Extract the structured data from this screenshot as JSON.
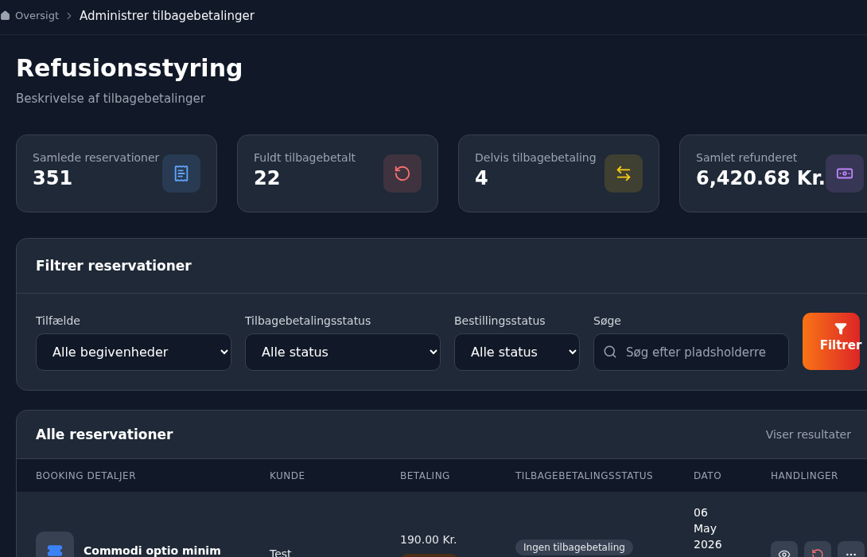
{
  "breadcrumb": [
    {
      "label": "Oversigt",
      "kind": "home"
    },
    {
      "label": "Administrer tilbagebetalinger",
      "kind": "current"
    }
  ],
  "header": {
    "title": "Refusionsstyring",
    "subtitle": "Beskrivelse af tilbagebetalinger"
  },
  "stats": [
    {
      "label": "Samlede reservationer",
      "value": "351",
      "color": "#60a5fa"
    },
    {
      "label": "Fuldt tilbagebetalt",
      "value": "22",
      "color": "#f87171"
    },
    {
      "label": "Delvis tilbagebetaling",
      "value": "4",
      "color": "#facc15"
    },
    {
      "label": "Samlet refunderet",
      "value": "6,420.68 Kr.",
      "color": "#c084fc"
    }
  ],
  "filters": {
    "title": "Filtrer reservationer",
    "fields": [
      {
        "kind": "select",
        "label": "Tilfælde",
        "value": "Alle begivenheder"
      },
      {
        "kind": "select",
        "label": "Tilbagebetalingsstatus",
        "value": "Alle status"
      },
      {
        "kind": "select",
        "label": "Bestillingsstatus",
        "value": "Alle status"
      },
      {
        "kind": "search",
        "label": "Søge",
        "placeholder": "Søg efter pladsholderre"
      }
    ],
    "button": "Filtrer"
  },
  "table": {
    "title": "Alle reservationer",
    "summary": "Viser resultater",
    "columns": [
      "BOOKING DETALJER",
      "KUNDE",
      "BETALING",
      "TILBAGEBETALINGSSTATUS",
      "DATO",
      "HANDLINGER"
    ],
    "rows": [
      {
        "event": "Commodi optio minim",
        "customer": "Test",
        "amount": "190.00 Kr.",
        "refund_status": "Ingen tilbagebetaling",
        "date": [
          "06",
          "May",
          "2026"
        ]
      }
    ]
  }
}
